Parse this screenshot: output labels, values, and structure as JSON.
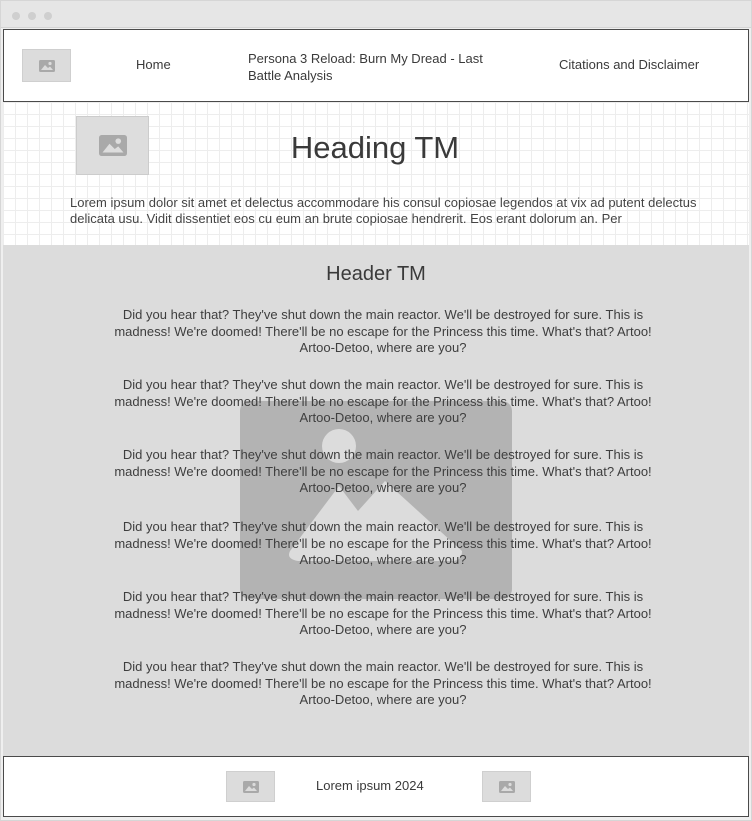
{
  "nav": {
    "logo_icon": "image-placeholder-icon",
    "home": "Home",
    "title": "Persona 3 Reload: Burn My Dread - Last Battle Analysis",
    "citations": "Citations and Disclaimer"
  },
  "hero": {
    "image_icon": "image-placeholder-icon",
    "heading": "Heading TM",
    "text": "Lorem ipsum dolor sit amet et delectus accommodare his consul copiosae legendos at vix ad putent delectus delicata usu. Vidit dissentiet eos cu eum an brute copiosae hendrerit. Eos erant dolorum an. Per"
  },
  "main": {
    "background_icon": "image-placeholder-icon",
    "header": "Header TM",
    "paragraphs": [
      "Did you hear that? They've shut down the main reactor. We'll be destroyed for sure. This is madness! We're doomed! There'll be no escape for the Princess this time. What's that? Artoo! Artoo-Detoo, where are you?",
      "Did you hear that? They've shut down the main reactor. We'll be destroyed for sure. This is madness! We're doomed! There'll be no escape for the Princess this time. What's that? Artoo! Artoo-Detoo, where are you?",
      "Did you hear that? They've shut down the main reactor. We'll be destroyed for sure. This is madness! We're doomed! There'll be no escape for the Princess this time. What's that? Artoo! Artoo-Detoo, where are you?",
      "Did you hear that? They've shut down the main reactor. We'll be destroyed for sure. This is madness! We're doomed! There'll be no escape for the Princess this time. What's that? Artoo! Artoo-Detoo, where are you?",
      "Did you hear that? They've shut down the main reactor. We'll be destroyed for sure. This is madness! We're doomed! There'll be no escape for the Princess this time. What's that? Artoo! Artoo-Detoo, where are you?",
      "Did you hear that? They've shut down the main reactor. We'll be destroyed for sure. This is madness! We're doomed! There'll be no escape for the Princess this time. What's that? Artoo! Artoo-Detoo, where are you?"
    ]
  },
  "footer": {
    "text": "Lorem ipsum 2024",
    "left_icon": "image-placeholder-icon",
    "right_icon": "image-placeholder-icon"
  },
  "colors": {
    "main_bg": "#dcdcdc",
    "border": "#4a4a4a",
    "placeholder": "#b3b3b3"
  }
}
